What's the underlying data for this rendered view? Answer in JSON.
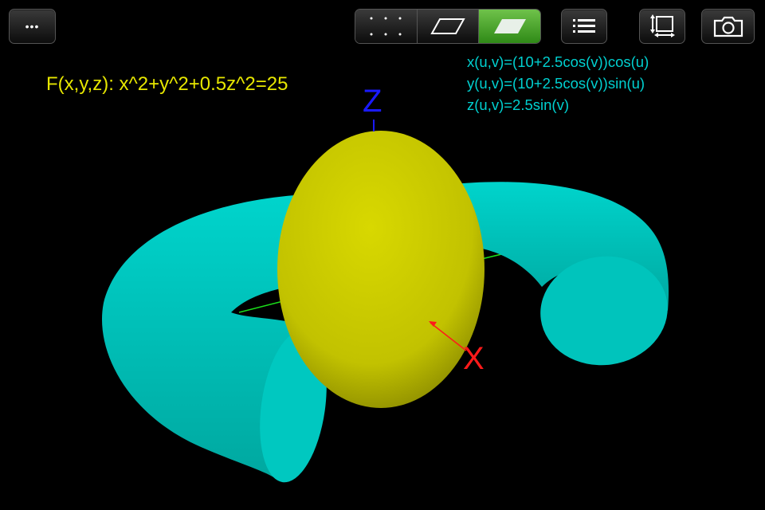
{
  "toolbar": {
    "more_label": "•••",
    "render_modes": [
      {
        "name": "points",
        "active": false
      },
      {
        "name": "wireframe",
        "active": false
      },
      {
        "name": "solid",
        "active": true
      }
    ],
    "accent_color": "#4aa82a"
  },
  "equations": {
    "implicit": "F(x,y,z): x^2+y^2+0.5z^2=25",
    "implicit_color": "#e6e600",
    "parametric": [
      "x(u,v)=(10+2.5cos(v))cos(u)",
      "y(u,v)=(10+2.5cos(v))sin(u)",
      "z(u,v)=2.5sin(v)"
    ],
    "parametric_color": "#00d0d0"
  },
  "axes": {
    "z_label": "Z",
    "x_label": "X",
    "colors": {
      "x": "#ff1a1a",
      "y": "#1adf1a",
      "z": "#1a1aff"
    }
  },
  "surfaces": {
    "ellipsoid_color": "#cccc00",
    "torus_color": "#00c8c0"
  }
}
